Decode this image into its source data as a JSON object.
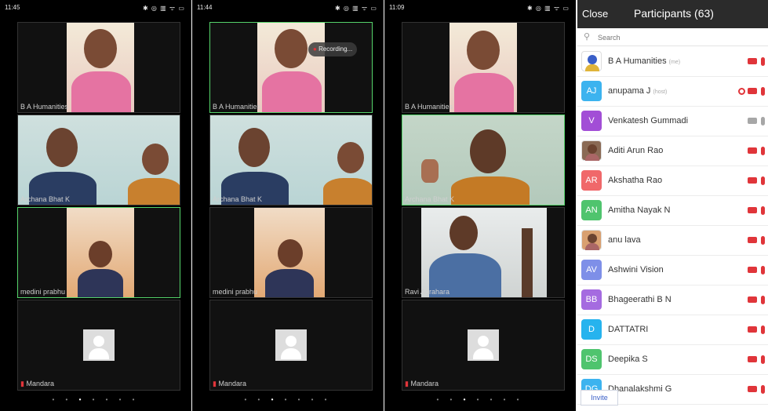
{
  "phones": [
    {
      "status": {
        "time": "11:45",
        "icons": "✱ ◎ ▥ ᯤ ▭"
      },
      "recording": "",
      "tiles": [
        {
          "name": "B A Humanities"
        },
        {
          "name": "Archana Bhat K"
        },
        {
          "name": "medini prabhu"
        },
        {
          "name": "Mandara"
        }
      ]
    },
    {
      "status": {
        "time": "11:44",
        "icons": "✱ ◎ ▥ ᯤ ▭"
      },
      "recording": "Recording...",
      "tiles": [
        {
          "name": "B A Humanities"
        },
        {
          "name": "Archana Bhat K"
        },
        {
          "name": "medini prabhu"
        },
        {
          "name": "Mandara"
        }
      ]
    },
    {
      "status": {
        "time": "11:09",
        "icons": "✱ ◎ ▥ ᯤ ▭"
      },
      "recording": "",
      "tiles": [
        {
          "name": "B A Humanities"
        },
        {
          "name": "Archana Bhat K"
        },
        {
          "name": "Ravi Agrahara"
        },
        {
          "name": "Mandara"
        }
      ]
    }
  ],
  "participants": {
    "close_label": "Close",
    "title": "Participants (63)",
    "search_placeholder": "Search",
    "invite_label": "Invite",
    "rows": [
      {
        "initials": "",
        "name": "B A Humanities",
        "tag": "(me)",
        "color": "#ffffff"
      },
      {
        "initials": "AJ",
        "name": "anupama J",
        "tag": "(host)",
        "color": "#3cb3ef"
      },
      {
        "initials": "V",
        "name": "Venkatesh Gummadi",
        "tag": "",
        "color": "#a24ed6"
      },
      {
        "initials": "",
        "name": "Aditi Arun Rao",
        "tag": "",
        "color": "#8a6a55"
      },
      {
        "initials": "AR",
        "name": "Akshatha Rao",
        "tag": "",
        "color": "#f0686a"
      },
      {
        "initials": "AN",
        "name": "Amitha Nayak N",
        "tag": "",
        "color": "#4fc46e"
      },
      {
        "initials": "",
        "name": "anu lava",
        "tag": "",
        "color": "#d9a070"
      },
      {
        "initials": "AV",
        "name": "Ashwini Vision",
        "tag": "",
        "color": "#7e8fe8"
      },
      {
        "initials": "BB",
        "name": "Bhageerathi B N",
        "tag": "",
        "color": "#a56be0"
      },
      {
        "initials": "D",
        "name": "DATTATRI",
        "tag": "",
        "color": "#26b3ee"
      },
      {
        "initials": "DS",
        "name": "Deepika S",
        "tag": "",
        "color": "#4fc46e"
      },
      {
        "initials": "DG",
        "name": "Dhanalakshmi G",
        "tag": "",
        "color": "#3cb3ef"
      }
    ]
  }
}
